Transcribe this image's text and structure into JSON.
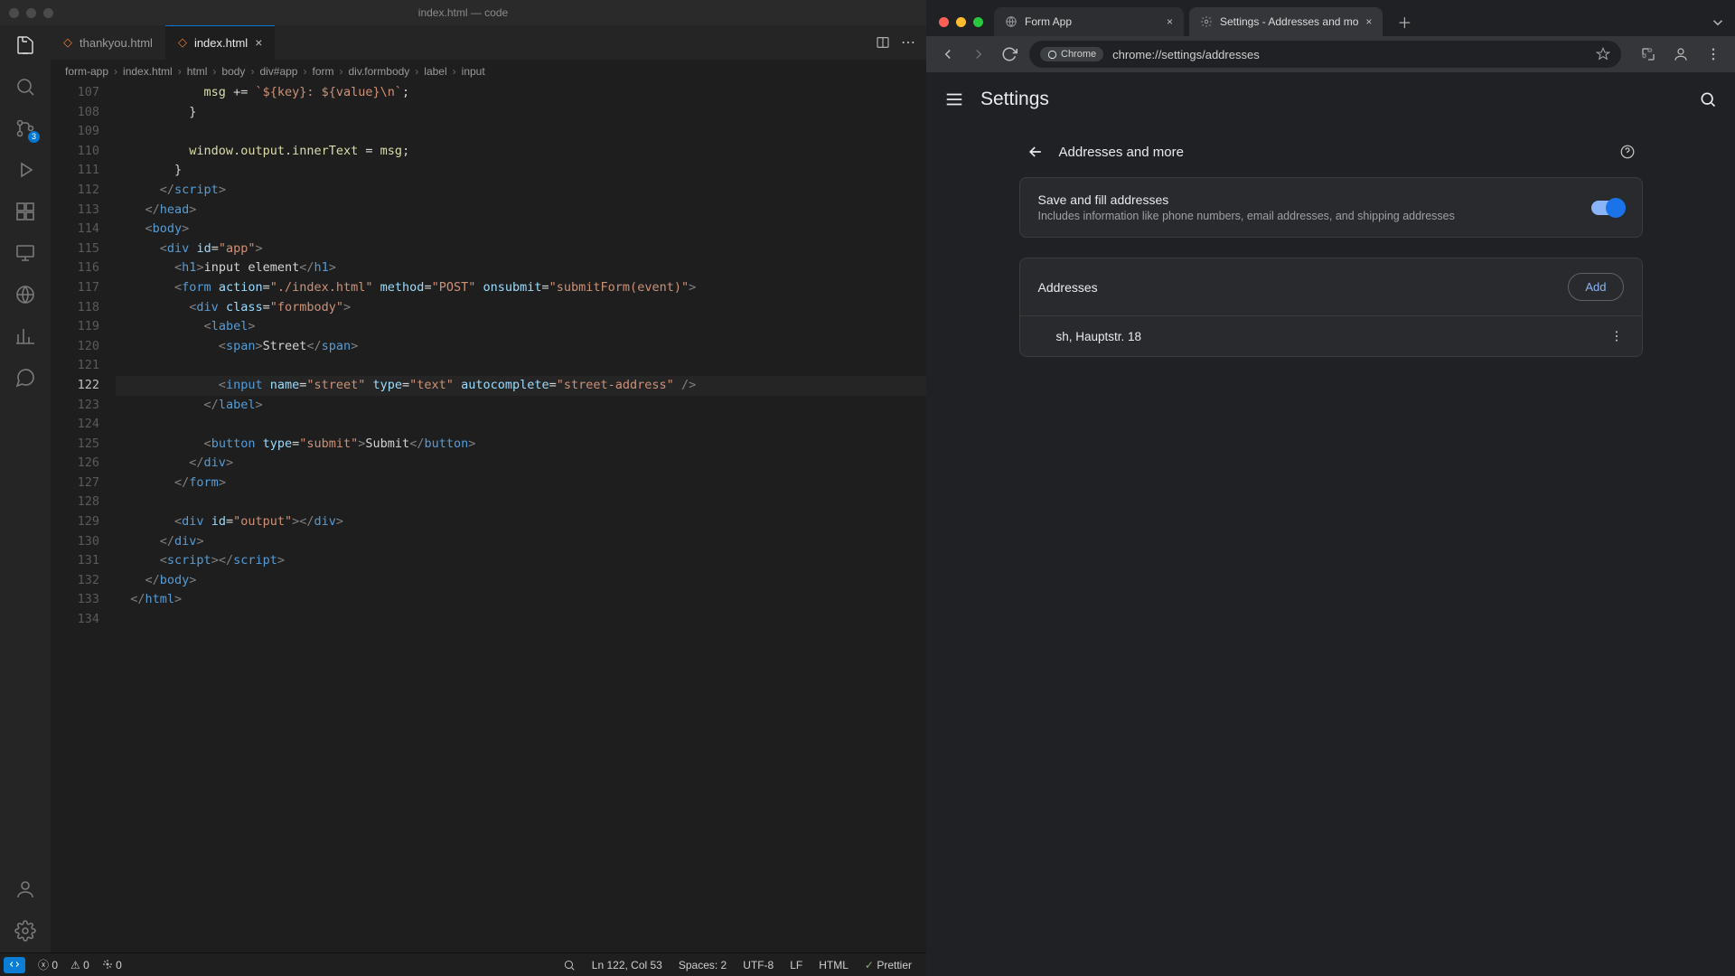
{
  "vscode": {
    "window_title": "index.html — code",
    "tabs": [
      {
        "label": "thankyou.html"
      },
      {
        "label": "index.html"
      }
    ],
    "active_tab": 1,
    "breadcrumbs": [
      "form-app",
      "index.html",
      "html",
      "body",
      "div#app",
      "form",
      "div.formbody",
      "label",
      "input"
    ],
    "activity_badge": "3",
    "gutter_start": 107,
    "current_line": 122,
    "lines": [
      {
        "n": 107,
        "raw": "            msg += `${key}: ${value}\\n`;",
        "tokens": [
          [
            "            ",
            "t-txt"
          ],
          [
            "msg ",
            "t-id"
          ],
          [
            "+= ",
            "t-pun"
          ],
          [
            "`${key}: ${value}\\n`",
            "t-str"
          ],
          [
            ";",
            "t-pun"
          ]
        ]
      },
      {
        "n": 108,
        "raw": "          }",
        "tokens": [
          [
            "          }",
            "t-pun"
          ]
        ]
      },
      {
        "n": 109,
        "raw": "",
        "tokens": []
      },
      {
        "n": 110,
        "raw": "          window.output.innerText = msg;",
        "tokens": [
          [
            "          ",
            "t-txt"
          ],
          [
            "window",
            "t-id"
          ],
          [
            ".",
            "t-pun"
          ],
          [
            "output",
            "t-id"
          ],
          [
            ".",
            "t-pun"
          ],
          [
            "innerText",
            "t-id"
          ],
          [
            " = ",
            "t-pun"
          ],
          [
            "msg",
            "t-id"
          ],
          [
            ";",
            "t-pun"
          ]
        ]
      },
      {
        "n": 111,
        "raw": "        }",
        "tokens": [
          [
            "        }",
            "t-pun"
          ]
        ]
      },
      {
        "n": 112,
        "raw": "      </script␛>",
        "tokens": [
          [
            "      ",
            "t-txt"
          ],
          [
            "</",
            "t-br"
          ],
          [
            "script",
            "t-tag"
          ],
          [
            ">",
            "t-br"
          ]
        ]
      },
      {
        "n": 113,
        "raw": "    </head>",
        "tokens": [
          [
            "    ",
            "t-txt"
          ],
          [
            "</",
            "t-br"
          ],
          [
            "head",
            "t-tag"
          ],
          [
            ">",
            "t-br"
          ]
        ]
      },
      {
        "n": 114,
        "raw": "    <body>",
        "tokens": [
          [
            "    ",
            "t-txt"
          ],
          [
            "<",
            "t-br"
          ],
          [
            "body",
            "t-tag"
          ],
          [
            ">",
            "t-br"
          ]
        ]
      },
      {
        "n": 115,
        "raw": "      <div id=\"app\">",
        "tokens": [
          [
            "      ",
            "t-txt"
          ],
          [
            "<",
            "t-br"
          ],
          [
            "div",
            "t-tag"
          ],
          [
            " id",
            "t-attr"
          ],
          [
            "=",
            "t-pun"
          ],
          [
            "\"app\"",
            "t-str"
          ],
          [
            ">",
            "t-br"
          ]
        ]
      },
      {
        "n": 116,
        "raw": "        <h1>input element</h1>",
        "tokens": [
          [
            "        ",
            "t-txt"
          ],
          [
            "<",
            "t-br"
          ],
          [
            "h1",
            "t-tag"
          ],
          [
            ">",
            "t-br"
          ],
          [
            "input element",
            "t-txt"
          ],
          [
            "</",
            "t-br"
          ],
          [
            "h1",
            "t-tag"
          ],
          [
            ">",
            "t-br"
          ]
        ]
      },
      {
        "n": 117,
        "raw": "        <form action=\"./index.html\" method=\"POST\" onsubmit=\"submitForm(event)\">",
        "tokens": [
          [
            "        ",
            "t-txt"
          ],
          [
            "<",
            "t-br"
          ],
          [
            "form",
            "t-tag"
          ],
          [
            " action",
            "t-attr"
          ],
          [
            "=",
            "t-pun"
          ],
          [
            "\"./index.html\"",
            "t-str"
          ],
          [
            " method",
            "t-attr"
          ],
          [
            "=",
            "t-pun"
          ],
          [
            "\"POST\"",
            "t-str"
          ],
          [
            " onsubmit",
            "t-attr"
          ],
          [
            "=",
            "t-pun"
          ],
          [
            "\"submitForm(event)\"",
            "t-str"
          ],
          [
            ">",
            "t-br"
          ]
        ]
      },
      {
        "n": 118,
        "raw": "          <div class=\"formbody\">",
        "tokens": [
          [
            "          ",
            "t-txt"
          ],
          [
            "<",
            "t-br"
          ],
          [
            "div",
            "t-tag"
          ],
          [
            " class",
            "t-attr"
          ],
          [
            "=",
            "t-pun"
          ],
          [
            "\"formbody\"",
            "t-str"
          ],
          [
            ">",
            "t-br"
          ]
        ]
      },
      {
        "n": 119,
        "raw": "            <label>",
        "tokens": [
          [
            "            ",
            "t-txt"
          ],
          [
            "<",
            "t-br"
          ],
          [
            "label",
            "t-tag"
          ],
          [
            ">",
            "t-br"
          ]
        ]
      },
      {
        "n": 120,
        "raw": "              <span>Street</span>",
        "tokens": [
          [
            "              ",
            "t-txt"
          ],
          [
            "<",
            "t-br"
          ],
          [
            "span",
            "t-tag"
          ],
          [
            ">",
            "t-br"
          ],
          [
            "Street",
            "t-txt"
          ],
          [
            "</",
            "t-br"
          ],
          [
            "span",
            "t-tag"
          ],
          [
            ">",
            "t-br"
          ]
        ]
      },
      {
        "n": 121,
        "raw": "",
        "tokens": []
      },
      {
        "n": 122,
        "raw": "              <input name=\"street\" type=\"text\" autocomplete=\"street-address\" />",
        "tokens": [
          [
            "              ",
            "t-txt"
          ],
          [
            "<",
            "t-br"
          ],
          [
            "input",
            "t-tag"
          ],
          [
            " name",
            "t-attr"
          ],
          [
            "=",
            "t-pun"
          ],
          [
            "\"street\"",
            "t-str"
          ],
          [
            " type",
            "t-attr"
          ],
          [
            "=",
            "t-pun"
          ],
          [
            "\"text\"",
            "t-str"
          ],
          [
            " autocomplete",
            "t-attr"
          ],
          [
            "=",
            "t-pun"
          ],
          [
            "\"street-address\"",
            "t-str"
          ],
          [
            " />",
            "t-br"
          ]
        ]
      },
      {
        "n": 123,
        "raw": "            </label>",
        "tokens": [
          [
            "            ",
            "t-txt"
          ],
          [
            "</",
            "t-br"
          ],
          [
            "label",
            "t-tag"
          ],
          [
            ">",
            "t-br"
          ]
        ]
      },
      {
        "n": 124,
        "raw": "",
        "tokens": []
      },
      {
        "n": 125,
        "raw": "            <button type=\"submit\">Submit</button>",
        "tokens": [
          [
            "            ",
            "t-txt"
          ],
          [
            "<",
            "t-br"
          ],
          [
            "button",
            "t-tag"
          ],
          [
            " type",
            "t-attr"
          ],
          [
            "=",
            "t-pun"
          ],
          [
            "\"submit\"",
            "t-str"
          ],
          [
            ">",
            "t-br"
          ],
          [
            "Submit",
            "t-txt"
          ],
          [
            "</",
            "t-br"
          ],
          [
            "button",
            "t-tag"
          ],
          [
            ">",
            "t-br"
          ]
        ]
      },
      {
        "n": 126,
        "raw": "          </div>",
        "tokens": [
          [
            "          ",
            "t-txt"
          ],
          [
            "</",
            "t-br"
          ],
          [
            "div",
            "t-tag"
          ],
          [
            ">",
            "t-br"
          ]
        ]
      },
      {
        "n": 127,
        "raw": "        </form>",
        "tokens": [
          [
            "        ",
            "t-txt"
          ],
          [
            "</",
            "t-br"
          ],
          [
            "form",
            "t-tag"
          ],
          [
            ">",
            "t-br"
          ]
        ]
      },
      {
        "n": 128,
        "raw": "",
        "tokens": []
      },
      {
        "n": 129,
        "raw": "        <div id=\"output\"></div>",
        "tokens": [
          [
            "        ",
            "t-txt"
          ],
          [
            "<",
            "t-br"
          ],
          [
            "div",
            "t-tag"
          ],
          [
            " id",
            "t-attr"
          ],
          [
            "=",
            "t-pun"
          ],
          [
            "\"output\"",
            "t-str"
          ],
          [
            ">",
            "t-br"
          ],
          [
            "</",
            "t-br"
          ],
          [
            "div",
            "t-tag"
          ],
          [
            ">",
            "t-br"
          ]
        ]
      },
      {
        "n": 130,
        "raw": "      </div>",
        "tokens": [
          [
            "      ",
            "t-txt"
          ],
          [
            "</",
            "t-br"
          ],
          [
            "div",
            "t-tag"
          ],
          [
            ">",
            "t-br"
          ]
        ]
      },
      {
        "n": 131,
        "raw": "      <script␛></script␛>",
        "tokens": [
          [
            "      ",
            "t-txt"
          ],
          [
            "<",
            "t-br"
          ],
          [
            "script",
            "t-tag"
          ],
          [
            ">",
            "t-br"
          ],
          [
            "</",
            "t-br"
          ],
          [
            "script",
            "t-tag"
          ],
          [
            ">",
            "t-br"
          ]
        ]
      },
      {
        "n": 132,
        "raw": "    </body>",
        "tokens": [
          [
            "    ",
            "t-txt"
          ],
          [
            "</",
            "t-br"
          ],
          [
            "body",
            "t-tag"
          ],
          [
            ">",
            "t-br"
          ]
        ]
      },
      {
        "n": 133,
        "raw": "  </html>",
        "tokens": [
          [
            "  ",
            "t-txt"
          ],
          [
            "</",
            "t-br"
          ],
          [
            "html",
            "t-tag"
          ],
          [
            ">",
            "t-br"
          ]
        ]
      },
      {
        "n": 134,
        "raw": "",
        "tokens": []
      }
    ],
    "status": {
      "errors": "0",
      "warnings": "0",
      "ports": "0",
      "cursor": "Ln 122, Col 53",
      "spaces": "Spaces: 2",
      "encoding": "UTF-8",
      "eol": "LF",
      "lang": "HTML",
      "formatter": "Prettier"
    }
  },
  "chrome": {
    "tabs": [
      {
        "label": "Form App",
        "fav": "globe"
      },
      {
        "label": "Settings - Addresses and mo",
        "fav": "gear"
      }
    ],
    "active_tab": 1,
    "toolbar": {
      "chip_label": "Chrome",
      "url": "chrome://settings/addresses"
    },
    "settings": {
      "app_title": "Settings",
      "section_title": "Addresses and more",
      "toggle": {
        "title": "Save and fill addresses",
        "subtitle": "Includes information like phone numbers, email addresses, and shipping addresses"
      },
      "addresses_header": "Addresses",
      "add_label": "Add",
      "entries": [
        {
          "label": "sh, Hauptstr. 18"
        }
      ]
    }
  }
}
